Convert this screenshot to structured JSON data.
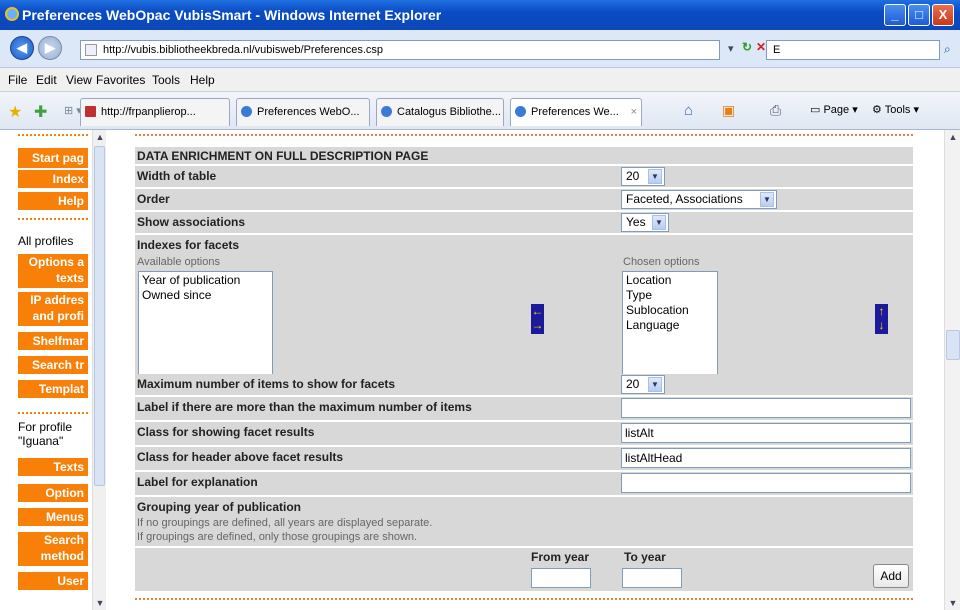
{
  "window": {
    "title": "Preferences WebOpac VubisSmart - Windows Internet Explorer",
    "min": "_",
    "max": "□",
    "close": "X"
  },
  "address": {
    "url": "http://vubis.bibliotheekbreda.nl/vubisweb/Preferences.csp",
    "search_value": "E"
  },
  "menu": {
    "file": "File",
    "edit": "Edit",
    "view": "View",
    "favorites": "Favorites",
    "tools": "Tools",
    "help": "Help"
  },
  "tabs": [
    {
      "label": "http://frpanplierop..."
    },
    {
      "label": "Preferences WebO..."
    },
    {
      "label": "Catalogus Bibliothe..."
    },
    {
      "label": "Preferences We..."
    }
  ],
  "toolbar": {
    "page": "Page ▾",
    "tools": "Tools ▾"
  },
  "sidebar": {
    "start": "Start pag",
    "index": "Index",
    "help": "Help",
    "all_profiles": "All profiles",
    "options_texts_1": "Options a",
    "options_texts_2": "texts",
    "ip_1": "IP addres",
    "ip_2": "and profi",
    "shelfmark": "Shelfmar",
    "search_tr": "Search tr",
    "template": "Templat",
    "for_profile_1": "For profile",
    "for_profile_2": "\"Iguana\"",
    "texts": "Texts",
    "options": "Option",
    "menus": "Menus",
    "search_methods_1": "Search",
    "search_methods_2": "method",
    "user": "User"
  },
  "form": {
    "section_title": "DATA ENRICHMENT ON FULL DESCRIPTION PAGE",
    "width_label": "Width of table",
    "width_value": "20",
    "order_label": "Order",
    "order_value": "Faceted, Associations",
    "assoc_label": "Show associations",
    "assoc_value": "Yes",
    "indexes_label": "Indexes for facets",
    "available_label": "Available options",
    "chosen_label": "Chosen options",
    "available_options": [
      "Year of publication",
      "Owned since"
    ],
    "chosen_options": [
      "Location",
      "Type",
      "Sublocation",
      "Language"
    ],
    "max_items_label": "Maximum number of items to show for facets",
    "max_items_value": "20",
    "more_label": "Label if there are more than the maximum number of items",
    "more_value": "",
    "class_results_label": "Class for showing facet results",
    "class_results_value": "listAlt",
    "class_header_label": "Class for header above facet results",
    "class_header_value": "listAltHead",
    "explanation_label": "Label for explanation",
    "explanation_value": "",
    "grouping_label": "Grouping year of publication",
    "grouping_hint_1": "If no groupings are defined, all years are displayed separate.",
    "grouping_hint_2": "If groupings are defined, only those groupings are shown.",
    "from_year_label": "From year",
    "to_year_label": "To year",
    "add_button": "Add"
  },
  "colors": {
    "accent": "#f88008",
    "title_bar": "#0a4bc4",
    "row_bg": "#d8d8d8"
  },
  "icons": [
    "ie-logo-icon",
    "back-icon",
    "forward-icon",
    "refresh-icon",
    "stop-icon",
    "search-icon",
    "favorites-star-icon",
    "add-favorites-icon",
    "home-icon",
    "feed-icon",
    "print-icon",
    "page-icon",
    "tools-icon",
    "arrow-left-icon",
    "arrow-right-icon",
    "arrow-up-icon",
    "arrow-down-icon"
  ]
}
